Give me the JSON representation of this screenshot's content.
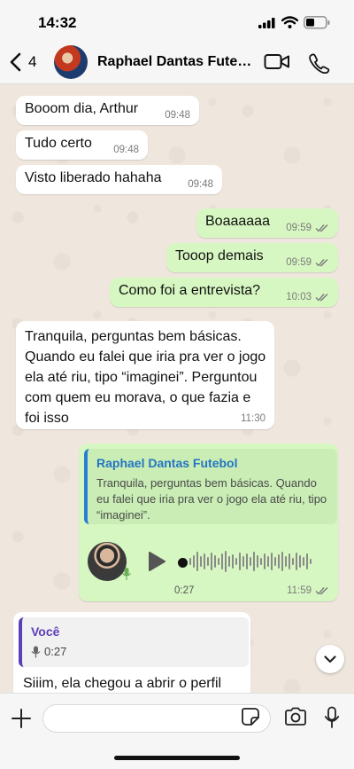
{
  "status": {
    "time": "14:32"
  },
  "header": {
    "back_count": "4",
    "contact_name": "Raphael Dantas Futebol"
  },
  "messages": [
    {
      "text": "Booom dia, Arthur",
      "time": "09:48"
    },
    {
      "text": "Tudo certo",
      "time": "09:48"
    },
    {
      "text": "Visto liberado hahaha",
      "time": "09:48"
    },
    {
      "text": "Boaaaaaa",
      "time": "09:59"
    },
    {
      "text": "Tooop demais",
      "time": "09:59"
    },
    {
      "text": "Como foi a entrevista?",
      "time": "10:03"
    },
    {
      "text": "Tranquila, perguntas bem básicas. Quando eu falei que iria pra ver o jogo ela até riu, tipo “imaginei”. Perguntou com quem eu morava, o que fazia e foi isso",
      "time": "11:30"
    }
  ],
  "reply": {
    "quote_author": "Raphael Dantas Futebol",
    "quote_text": "Tranquila, perguntas bem básicas. Quando eu falei que iria pra ver o jogo ela até riu, tipo “imaginei”.",
    "voice_duration": "0:27",
    "time": "11:59"
  },
  "last_message": {
    "quote_author": "Você",
    "quote_duration": "0:27",
    "text": "Siiim, ela chegou a abrir o perfil"
  },
  "icons": [
    "chevron-left-icon",
    "video-camera-icon",
    "phone-icon",
    "play-icon",
    "microphone-icon",
    "chevron-down-icon",
    "plus-icon",
    "sticker-icon",
    "camera-icon"
  ],
  "colors": {
    "incoming": "#ffffff",
    "outgoing": "#d7f7c2",
    "read_ticks": "#7b7b7b",
    "quote_bar": "#2b7fd3",
    "you_bar": "#5a3fb6"
  }
}
